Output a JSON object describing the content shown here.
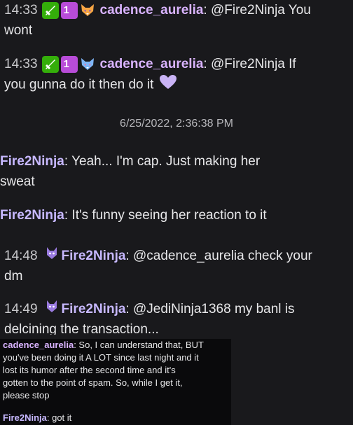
{
  "messages": [
    {
      "time": "14:33",
      "user": "cadence_aurelia",
      "text": "@Fire2Ninja You wont",
      "line1": "@Fire2Ninja You",
      "line2": "wont"
    },
    {
      "time": "14:33",
      "user": "cadence_aurelia",
      "text": "@Fire2Ninja If you gunna do it then do it",
      "line1": "@Fire2Ninja If",
      "line2": "you gunna do it then do it"
    },
    {
      "user": "Fire2Ninja",
      "text": "Yeah... I'm cap. Just making her sweat",
      "line1": "Yeah... I'm cap. Just making her",
      "line2": "sweat"
    },
    {
      "user": "Fire2Ninja",
      "text": "It's funny seeing her reaction to it"
    },
    {
      "time": "14:48",
      "user": "Fire2Ninja",
      "text": "@cadence_aurelia check your dm",
      "line1": "@cadence_aurelia check your",
      "line2": "dm"
    },
    {
      "time": "14:49",
      "user": "Fire2Ninja",
      "text": "@JediNinja1368 my banl is delcining the transaction...",
      "line1": "@JediNinja1368 my banl is",
      "line2": "delcining the transaction..."
    },
    {
      "user": "cadence_aurelia",
      "text": "So, I can understand that, BUT you've been doing it A LOT since last night and it lost its humor after the second time and it's gotten to the point of spam. So, while I get it, please stop",
      "line1": "So, I can understand that, BUT",
      "line2": "you've been doing it A LOT since last night and it",
      "line3": "lost its humor after the second time and it's",
      "line4": "gotten to the point of spam. So, while I get it,",
      "line5": "please stop"
    },
    {
      "user": "Fire2Ninja",
      "text": "got it"
    }
  ],
  "date_divider": "6/25/2022, 2:36:38 PM",
  "colors": {
    "background": "#19191c",
    "cadence": "#d9b3ff",
    "fire": "#c7b8ff",
    "mod_badge": "#34ae0a",
    "sub_badge": "#b84cd8"
  },
  "icons": [
    "moderator-sword-icon",
    "subscriber-badge-icon",
    "fox-emote-icon",
    "heart-emote-icon",
    "cat-emote-icon"
  ],
  "badge_sub_text": "1"
}
